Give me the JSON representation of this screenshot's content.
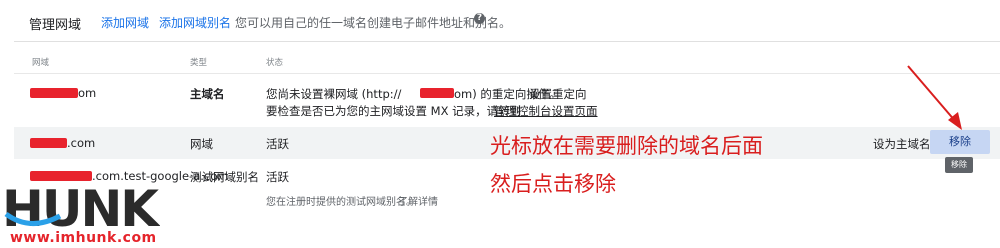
{
  "header": {
    "title": "管理网域",
    "add_domain": "添加网域",
    "add_alias": "添加网域别名",
    "description": "您可以用自己的任一域名创建电子邮件地址和别名。",
    "help": "?"
  },
  "columns": {
    "domain": "网域",
    "type": "类型",
    "status": "状态"
  },
  "rows": [
    {
      "domain_suffix": "om",
      "type": "主域名",
      "status_line1_prefix": "您尚未设置裸网域 (http://",
      "status_line1_suffix": "om) 的重定向操作。",
      "redirect_link": "设置重定向",
      "status_line2_prefix": "要检查是否已为您的主网域设置 MX 记录，请转到",
      "admin_link": "管理控制台设置页面"
    },
    {
      "domain_suffix": ".com",
      "type": "网域",
      "status": "活跃",
      "set_primary": "设为主域名",
      "remove": "移除",
      "tooltip": "移除"
    },
    {
      "domain_suffix": ".com.test-google-a.com",
      "type": "测试网域别名",
      "status": "活跃",
      "note": "您在注册时提供的测试网域别名。",
      "learn_more": "了解详情"
    }
  ],
  "annotation": {
    "line1": "光标放在需要删除的域名后面",
    "line2": "然后点击移除"
  },
  "logo": {
    "text": "HUNK",
    "url": "www.imhunk.com"
  },
  "colors": {
    "accent": "#1a73e8",
    "annotation": "#d91e1e",
    "redaction": "#e8232d"
  }
}
